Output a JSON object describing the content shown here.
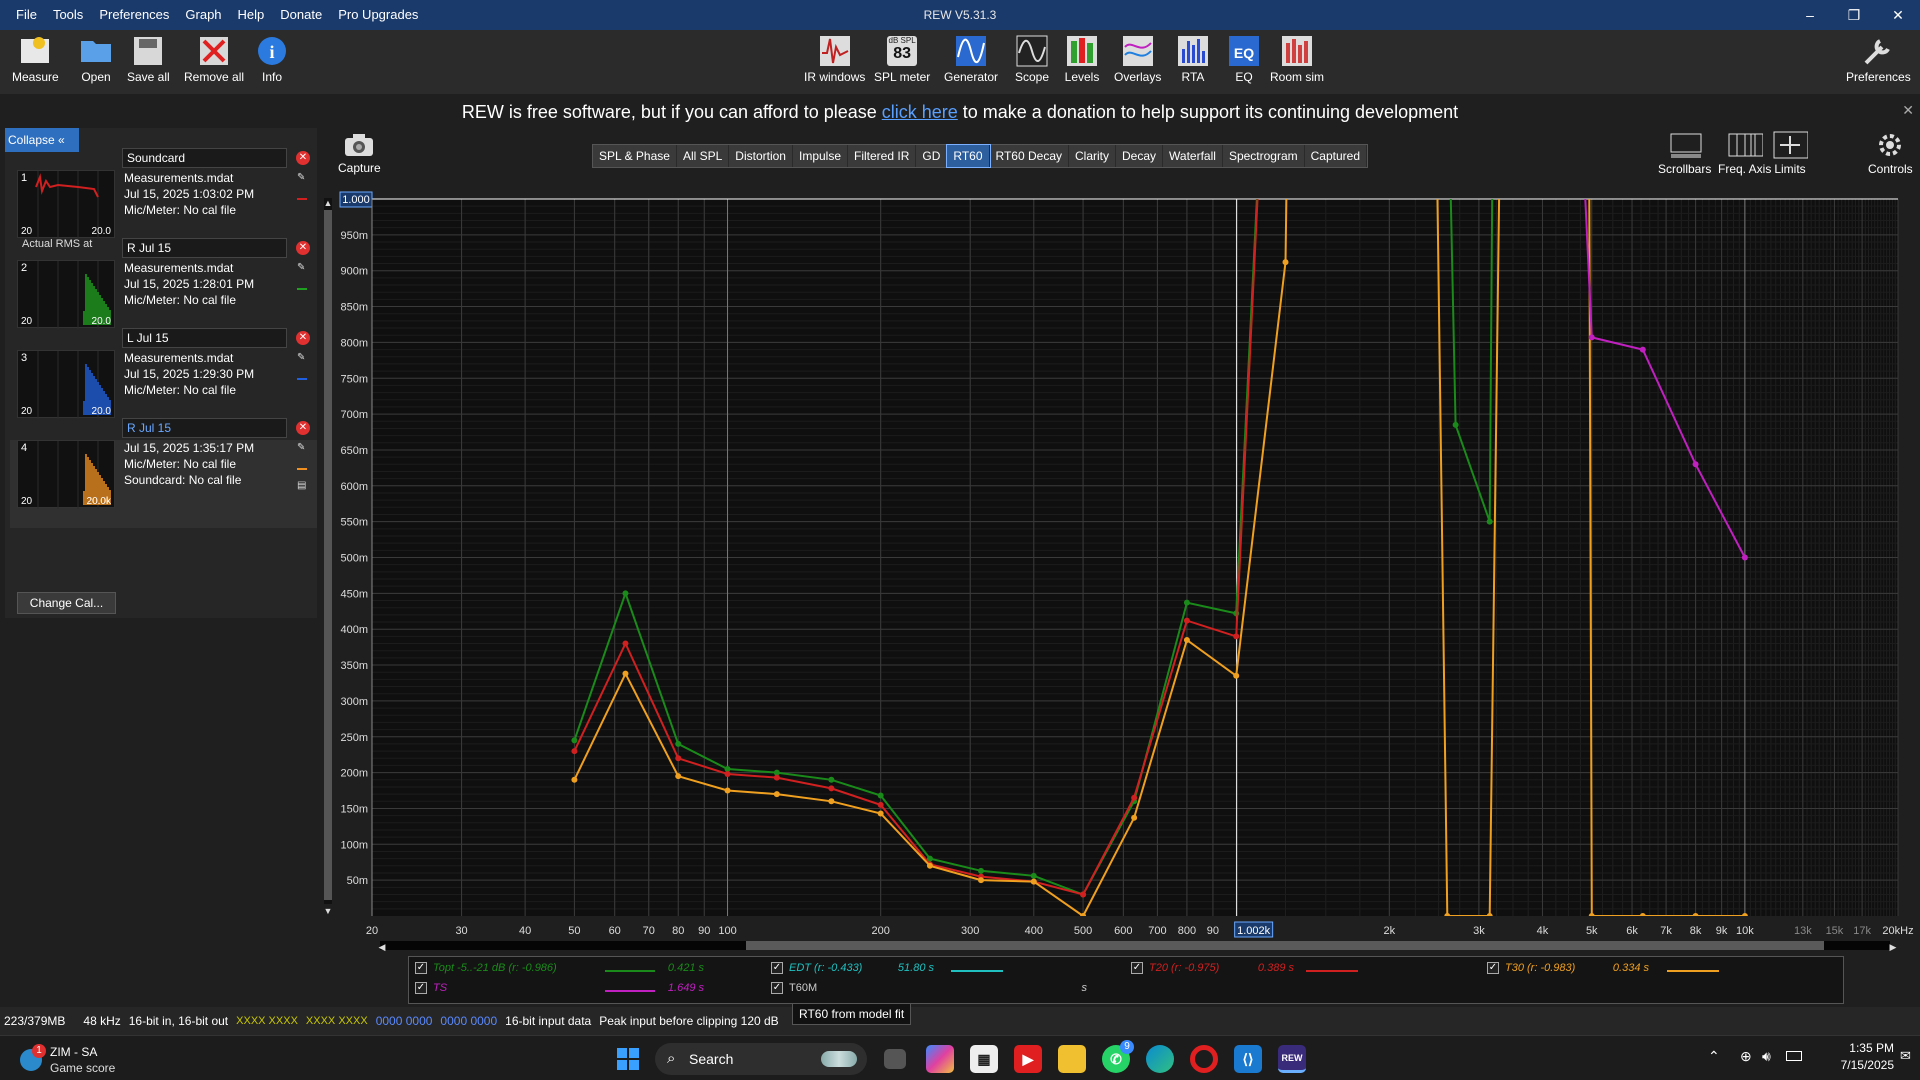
{
  "window": {
    "title": "REW V5.31.3",
    "controls": [
      "–",
      "❐",
      "✕"
    ]
  },
  "menu": [
    "File",
    "Tools",
    "Preferences",
    "Graph",
    "Help",
    "Donate",
    "Pro Upgrades"
  ],
  "toolbar": {
    "left": [
      {
        "label": "Measure",
        "icon": "measure-icon"
      },
      {
        "label": "Open",
        "icon": "folder-icon"
      },
      {
        "label": "Save all",
        "icon": "save-icon"
      },
      {
        "label": "Remove all",
        "icon": "remove-icon"
      },
      {
        "label": "Info",
        "icon": "info-icon"
      }
    ],
    "center": [
      {
        "label": "IR windows",
        "icon": "ir-windows-icon"
      },
      {
        "label": "SPL meter",
        "icon": "spl-meter-icon",
        "badge_top": "dB SPL",
        "badge_value": "83"
      },
      {
        "label": "Generator",
        "icon": "generator-icon"
      },
      {
        "label": "Scope",
        "icon": "scope-icon"
      },
      {
        "label": "Levels",
        "icon": "levels-icon"
      },
      {
        "label": "Overlays",
        "icon": "overlays-icon"
      },
      {
        "label": "RTA",
        "icon": "rta-icon"
      },
      {
        "label": "EQ",
        "icon": "eq-icon"
      },
      {
        "label": "Room sim",
        "icon": "room-sim-icon"
      }
    ],
    "right": {
      "label": "Preferences",
      "icon": "wrench-icon"
    }
  },
  "donate": {
    "before": "REW is free software, but if you can afford to please ",
    "link": "click here",
    "after": " to make a donation to help support its continuing development"
  },
  "panel": {
    "collapse_label": "Collapse",
    "collapse_icon": "«",
    "measurements": [
      {
        "num": "1",
        "name": "Soundcard",
        "lines": [
          "Measurements.mdat",
          "Jul 15, 2025 1:03:02 PM",
          "Mic/Meter: No cal file"
        ],
        "ax_left": "20",
        "ax_right": "20.0",
        "thumb_color": "#d02020",
        "extra": "Actual RMS at"
      },
      {
        "num": "2",
        "name": "R Jul 15",
        "lines": [
          "Measurements.mdat",
          "Jul 15, 2025 1:28:01 PM",
          "Mic/Meter: No cal file"
        ],
        "ax_left": "20",
        "ax_right": "20.0",
        "thumb_color": "#20a020"
      },
      {
        "num": "3",
        "name": "L Jul 15",
        "lines": [
          "Measurements.mdat",
          "Jul 15, 2025 1:29:30 PM",
          "Mic/Meter: No cal file"
        ],
        "ax_left": "20",
        "ax_right": "20.0",
        "thumb_color": "#2060e0"
      },
      {
        "num": "4",
        "name": "R Jul 15",
        "lines": [
          "Jul 15, 2025 1:35:17 PM",
          "Mic/Meter: No cal file",
          "Soundcard: No cal file"
        ],
        "ax_left": "20",
        "ax_right": "20.0k",
        "thumb_color": "#f09020",
        "selected": true
      }
    ],
    "change_cal": "Change Cal..."
  },
  "capture": {
    "label": "Capture",
    "icon": "camera-icon"
  },
  "tabs": [
    {
      "label": "SPL & Phase"
    },
    {
      "label": "All SPL"
    },
    {
      "label": "Distortion"
    },
    {
      "label": "Impulse"
    },
    {
      "label": "Filtered IR"
    },
    {
      "label": "GD"
    },
    {
      "label": "RT60",
      "active": true
    },
    {
      "label": "RT60 Decay"
    },
    {
      "label": "Clarity"
    },
    {
      "label": "Decay"
    },
    {
      "label": "Waterfall"
    },
    {
      "label": "Spectrogram"
    },
    {
      "label": "Captured"
    }
  ],
  "right_tools": [
    {
      "label": "Scrollbars",
      "icon": "scrollbars-icon"
    },
    {
      "label": "Freq. Axis",
      "icon": "freq-axis-icon"
    },
    {
      "label": "Limits",
      "icon": "limits-icon"
    },
    {
      "label": "Controls",
      "icon": "gear-icon"
    }
  ],
  "chart_data": {
    "type": "line",
    "x_scale": "log",
    "xlim": [
      20,
      20000
    ],
    "ylim": [
      0,
      1.0
    ],
    "grid": true,
    "y_ticks": [
      {
        "v": 1.0,
        "label": "1.000"
      },
      {
        "v": 0.95,
        "label": "950m"
      },
      {
        "v": 0.9,
        "label": "900m"
      },
      {
        "v": 0.85,
        "label": "850m"
      },
      {
        "v": 0.8,
        "label": "800m"
      },
      {
        "v": 0.75,
        "label": "750m"
      },
      {
        "v": 0.7,
        "label": "700m"
      },
      {
        "v": 0.65,
        "label": "650m"
      },
      {
        "v": 0.6,
        "label": "600m"
      },
      {
        "v": 0.55,
        "label": "550m"
      },
      {
        "v": 0.5,
        "label": "500m"
      },
      {
        "v": 0.45,
        "label": "450m"
      },
      {
        "v": 0.4,
        "label": "400m"
      },
      {
        "v": 0.35,
        "label": "350m"
      },
      {
        "v": 0.3,
        "label": "300m"
      },
      {
        "v": 0.25,
        "label": "250m"
      },
      {
        "v": 0.2,
        "label": "200m"
      },
      {
        "v": 0.15,
        "label": "150m"
      },
      {
        "v": 0.1,
        "label": "100m"
      },
      {
        "v": 0.05,
        "label": "50m"
      }
    ],
    "x_ticks": [
      {
        "v": 20,
        "label": "20"
      },
      {
        "v": 30,
        "label": "30"
      },
      {
        "v": 40,
        "label": "40"
      },
      {
        "v": 50,
        "label": "50"
      },
      {
        "v": 60,
        "label": "60"
      },
      {
        "v": 70,
        "label": "70"
      },
      {
        "v": 80,
        "label": "80"
      },
      {
        "v": 90,
        "label": "90"
      },
      {
        "v": 100,
        "label": "100"
      },
      {
        "v": 200,
        "label": "200"
      },
      {
        "v": 300,
        "label": "300"
      },
      {
        "v": 400,
        "label": "400"
      },
      {
        "v": 500,
        "label": "500"
      },
      {
        "v": 600,
        "label": "600"
      },
      {
        "v": 700,
        "label": "700"
      },
      {
        "v": 800,
        "label": "800"
      },
      {
        "v": 900,
        "label": "90"
      },
      {
        "v": 2000,
        "label": "2k"
      },
      {
        "v": 3000,
        "label": "3k"
      },
      {
        "v": 4000,
        "label": "4k"
      },
      {
        "v": 5000,
        "label": "5k"
      },
      {
        "v": 6000,
        "label": "6k"
      },
      {
        "v": 7000,
        "label": "7k"
      },
      {
        "v": 8000,
        "label": "8k"
      },
      {
        "v": 9000,
        "label": "9k"
      },
      {
        "v": 10000,
        "label": "10k"
      },
      {
        "v": 13000,
        "label": "13k",
        "dim": true
      },
      {
        "v": 15000,
        "label": "15k",
        "dim": true
      },
      {
        "v": 17000,
        "label": "17k",
        "dim": true
      },
      {
        "v": 20000,
        "label": "20kHz"
      }
    ],
    "cursor": {
      "x": 1002,
      "x_label": "1.002k",
      "y": 1.0,
      "y_label": "1.000"
    },
    "series": [
      {
        "name": "Topt",
        "color": "#1a8a1a",
        "points": [
          [
            50,
            0.245
          ],
          [
            63,
            0.45
          ],
          [
            80,
            0.24
          ],
          [
            100,
            0.205
          ],
          [
            125,
            0.2
          ],
          [
            160,
            0.19
          ],
          [
            200,
            0.168
          ],
          [
            250,
            0.08
          ],
          [
            315,
            0.063
          ],
          [
            400,
            0.056
          ],
          [
            500,
            0.03
          ],
          [
            630,
            0.16
          ],
          [
            800,
            0.437
          ],
          [
            1000,
            0.422
          ],
          [
            1250,
            1.8
          ],
          [
            2500,
            1.8
          ],
          [
            2700,
            0.685
          ],
          [
            3150,
            0.55
          ],
          [
            3250,
            1.8
          ],
          [
            5000,
            1.8
          ]
        ]
      },
      {
        "name": "T20",
        "color": "#d02020",
        "points": [
          [
            50,
            0.23
          ],
          [
            63,
            0.38
          ],
          [
            80,
            0.22
          ],
          [
            100,
            0.198
          ],
          [
            125,
            0.193
          ],
          [
            160,
            0.178
          ],
          [
            200,
            0.155
          ],
          [
            250,
            0.072
          ],
          [
            315,
            0.055
          ],
          [
            400,
            0.048
          ],
          [
            500,
            0.03
          ],
          [
            630,
            0.165
          ],
          [
            800,
            0.412
          ],
          [
            1000,
            0.39
          ],
          [
            1250,
            1.8
          ],
          [
            2400,
            1.8
          ]
        ]
      },
      {
        "name": "T30",
        "color": "#f0a020",
        "points": [
          [
            50,
            0.19
          ],
          [
            63,
            0.338
          ],
          [
            80,
            0.195
          ],
          [
            100,
            0.175
          ],
          [
            125,
            0.17
          ],
          [
            160,
            0.16
          ],
          [
            200,
            0.143
          ],
          [
            250,
            0.07
          ],
          [
            315,
            0.05
          ],
          [
            400,
            0.048
          ],
          [
            500,
            0.0
          ],
          [
            630,
            0.137
          ],
          [
            800,
            0.385
          ],
          [
            1000,
            0.335
          ],
          [
            1250,
            0.912
          ],
          [
            1300,
            1.8
          ],
          [
            2400,
            1.8
          ],
          [
            2600,
            0.0
          ],
          [
            3150,
            0.0
          ],
          [
            3400,
            1.8
          ],
          [
            4900,
            1.8
          ],
          [
            5000,
            0.0
          ],
          [
            6300,
            0.0
          ],
          [
            8000,
            0.0
          ],
          [
            10000,
            0.0
          ]
        ]
      },
      {
        "name": "TS",
        "color": "#c020c0",
        "points": [
          [
            4300,
            1.8
          ],
          [
            5000,
            0.807
          ],
          [
            6300,
            0.79
          ],
          [
            8000,
            0.63
          ],
          [
            10000,
            0.5
          ]
        ]
      }
    ]
  },
  "legend": [
    {
      "label": "Topt -5..-21 dB (r: -0.986)",
      "value": "0.421 s",
      "color": "#1a8a1a",
      "checked": true
    },
    {
      "label": "EDT (r: -0.433)",
      "value": "51.80 s",
      "color": "#20c0c0",
      "checked": true
    },
    {
      "label": "T20 (r: -0.975)",
      "value": "0.389 s",
      "color": "#d02020",
      "checked": true
    },
    {
      "label": "T30 (r: -0.983)",
      "value": "0.334 s",
      "color": "#f0a020",
      "checked": true
    },
    {
      "label": "TS",
      "value": "1.649 s",
      "color": "#c020c0",
      "checked": true
    },
    {
      "label": "T60M",
      "value": "s",
      "color": "#aaaaaa",
      "checked": true
    }
  ],
  "tooltip": "RT60 from model fit",
  "status": {
    "memory": "223/379MB",
    "rate": "48 kHz",
    "bits": "16-bit in, 16-bit out",
    "xx1": "XXXX XXXX",
    "xx2": "XXXX XXXX",
    "z1": "0000 0000",
    "z2": "0000 0000",
    "input": "16-bit input data",
    "peak": "Peak input before clipping 120 dB"
  },
  "taskbar": {
    "widget_title": "ZIM - SA",
    "widget_sub": "Game score",
    "widget_badge": "1",
    "search": "Search",
    "time": "1:35 PM",
    "date": "7/15/2025",
    "whatsapp_badge": "9"
  }
}
